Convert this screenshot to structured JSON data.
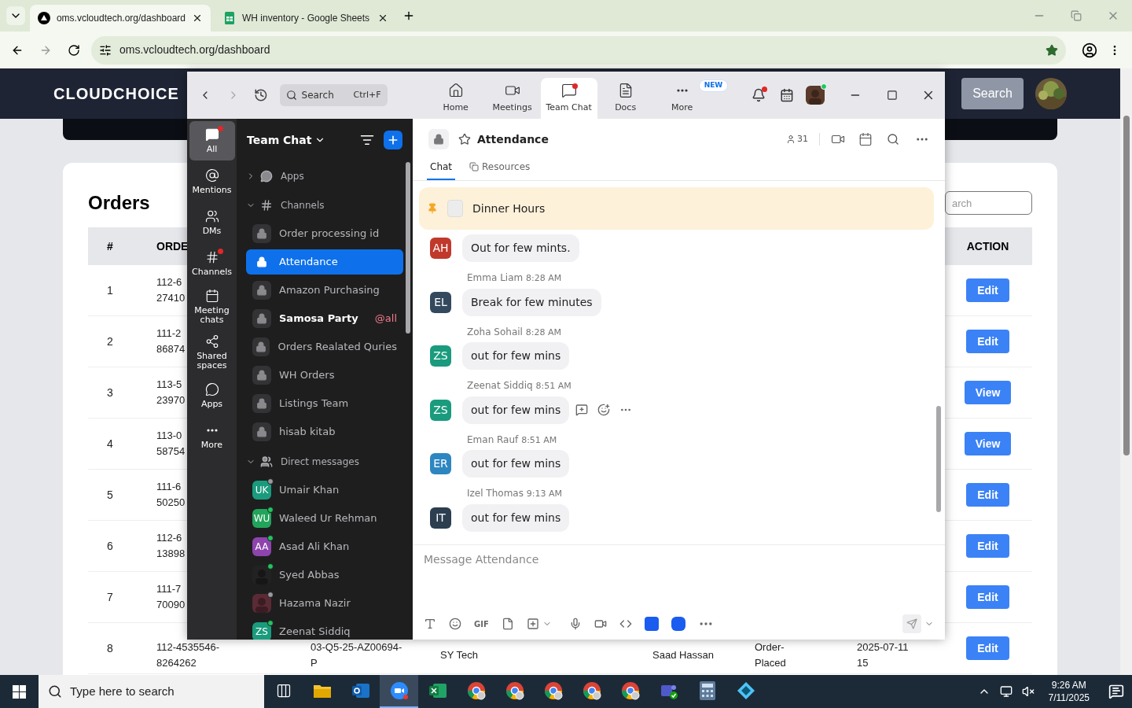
{
  "browser": {
    "tabs": [
      {
        "kind": "site",
        "title": "oms.vcloudtech.org/dashboard",
        "selected": true
      },
      {
        "kind": "sheet",
        "title": "WH inventory - Google Sheets",
        "selected": false
      }
    ],
    "address": "oms.vcloudtech.org/dashboard"
  },
  "site": {
    "logo": "CLOUDCHOICE",
    "search_button": "Search"
  },
  "orders": {
    "title": "Orders",
    "search_placeholder": "arch",
    "columns": [
      "#",
      "ORDE",
      "ACTION"
    ],
    "rows": [
      {
        "number": "1",
        "order": [
          "112-6",
          "27410"
        ],
        "action": "Edit"
      },
      {
        "number": "2",
        "order": [
          "111-2",
          "86874"
        ],
        "action": "Edit"
      },
      {
        "number": "3",
        "order": [
          "113-5",
          "23970"
        ],
        "action": "View"
      },
      {
        "number": "4",
        "order": [
          "113-0",
          "58754"
        ],
        "action": "View"
      },
      {
        "number": "5",
        "order": [
          "111-6",
          "50250"
        ],
        "action": "Edit"
      },
      {
        "number": "6",
        "order": [
          "112-6",
          "13898"
        ],
        "action": "Edit"
      },
      {
        "number": "7",
        "order": [
          "111-7",
          "70090"
        ],
        "action": "Edit"
      },
      {
        "number": "8",
        "order": [
          "112-4535546-",
          "8264262"
        ],
        "column_3": [
          "03-Q5-25-AZ00694-",
          "P"
        ],
        "column_4": [
          "SY Tech"
        ],
        "column_5": [
          "Saad Hassan"
        ],
        "column_6": [
          "Order-",
          "Placed"
        ],
        "column_7": [
          "2025-07-11",
          "15"
        ],
        "action": "Edit"
      }
    ]
  },
  "zoom": {
    "search": {
      "placeholder": "Search",
      "shortcut": "Ctrl+F"
    },
    "tabs": [
      {
        "kind": "home",
        "label": "Home",
        "selected": false,
        "dot": false
      },
      {
        "kind": "meetings",
        "label": "Meetings",
        "selected": false,
        "dot": false
      },
      {
        "kind": "chat",
        "label": "Team Chat",
        "selected": true,
        "dot": true
      },
      {
        "kind": "docs",
        "label": "Docs",
        "selected": false,
        "dot": false
      },
      {
        "kind": "more",
        "label": "More",
        "selected": false,
        "dot": false,
        "badge": "NEW"
      }
    ],
    "bell_dot": true,
    "rail": [
      {
        "kind": "all",
        "label": "All",
        "selected": true,
        "dot": true
      },
      {
        "kind": "mentions",
        "label": "Mentions",
        "selected": false,
        "dot": false
      },
      {
        "kind": "dms",
        "label": "DMs",
        "selected": false,
        "dot": false
      },
      {
        "kind": "channels",
        "label": "Channels",
        "selected": false,
        "dot": true
      },
      {
        "kind": "meeting",
        "label": "Meeting chats",
        "selected": false,
        "dot": false
      },
      {
        "kind": "shared",
        "label": "Shared spaces",
        "selected": false,
        "dot": false
      },
      {
        "kind": "apps",
        "label": "Apps",
        "selected": false,
        "dot": false
      },
      {
        "kind": "more",
        "label": "More",
        "selected": false,
        "dot": false
      }
    ],
    "sidebar": {
      "title": "Team Chat",
      "apps": {
        "label": "Apps",
        "expanded": false
      },
      "channels": {
        "label": "Channels",
        "expanded": true,
        "items": [
          {
            "name": "Order processing id",
            "selected": false,
            "unread": false
          },
          {
            "name": "Attendance",
            "selected": true,
            "unread": false
          },
          {
            "name": "Amazon Purchasing",
            "selected": false,
            "unread": false
          },
          {
            "name": "Samosa Party",
            "selected": false,
            "unread": true,
            "mention": "@all"
          },
          {
            "name": "Orders Realated Quries",
            "selected": false,
            "unread": false
          },
          {
            "name": "WH Orders",
            "selected": false,
            "unread": false
          },
          {
            "name": "Listings Team",
            "selected": false,
            "unread": false
          },
          {
            "name": "hisab kitab",
            "selected": false,
            "unread": false
          }
        ]
      },
      "direct": {
        "label": "Direct messages",
        "expanded": true,
        "items": [
          {
            "name": "Umair Khan",
            "initials": "UK",
            "color": "#1a9b7d",
            "online": false
          },
          {
            "name": "Waleed Ur Rehman",
            "initials": "WU",
            "color": "#22a45a",
            "online": true
          },
          {
            "name": "Asad Ali Khan",
            "initials": "AA",
            "color": "#8e44ad",
            "online": true
          },
          {
            "name": "Syed Abbas",
            "kind": "picture",
            "online": true
          },
          {
            "name": "Hazama Nazir",
            "kind": "picture",
            "online": false
          },
          {
            "name": "Zeenat Siddiq",
            "initials": "ZS",
            "color": "#1a9b7d",
            "online": true
          }
        ]
      }
    },
    "chat": {
      "title": "Attendance",
      "members": "31",
      "tabs": [
        {
          "label": "Chat",
          "selected": true
        },
        {
          "label": "Resources",
          "selected": false
        }
      ],
      "pinned": "Dinner Hours",
      "messages": [
        {
          "initials": "AH",
          "color": "#c0392b",
          "text": "Out for few mints.",
          "hovered": false
        },
        {
          "sender": "Emma Liam",
          "time": "8:28 AM",
          "initials": "EL",
          "color": "#34495e",
          "text": "Break for few minutes",
          "hovered": false
        },
        {
          "sender": "Zoha Sohail",
          "time": "8:28 AM",
          "initials": "ZS",
          "color": "#1a9b7d",
          "text": "out for few mins",
          "hovered": false
        },
        {
          "sender": "Zeenat Siddiq",
          "time": "8:51 AM",
          "initials": "ZS",
          "color": "#1a9b7d",
          "text": "out for few mins",
          "hovered": true
        },
        {
          "sender": "Eman Rauf",
          "time": "8:51 AM",
          "initials": "ER",
          "color": "#2e86c1",
          "text": "out for few mins",
          "hovered": false
        },
        {
          "sender": "Izel Thomas",
          "time": "9:13 AM",
          "initials": "IT",
          "color": "#2c3e50",
          "text": "out for few mins",
          "hovered": false
        }
      ],
      "composer_placeholder": "Message Attendance",
      "gif": "GIF"
    }
  },
  "taskbar": {
    "search_placeholder": "Type here to search",
    "time": "9:26 AM",
    "date": "7/11/2025",
    "apps": [
      {
        "kind": "taskview",
        "selected": false
      },
      {
        "kind": "folder",
        "selected": false
      },
      {
        "kind": "mail",
        "selected": false
      },
      {
        "kind": "video",
        "selected": true
      },
      {
        "kind": "sheet",
        "selected": false
      },
      {
        "kind": "browser",
        "selected": false
      },
      {
        "kind": "browser",
        "selected": false
      },
      {
        "kind": "browser",
        "selected": false
      },
      {
        "kind": "browser",
        "selected": false
      },
      {
        "kind": "browser",
        "selected": false
      },
      {
        "kind": "team",
        "selected": false
      },
      {
        "kind": "calculator",
        "selected": false
      },
      {
        "kind": "app",
        "selected": false
      }
    ]
  }
}
